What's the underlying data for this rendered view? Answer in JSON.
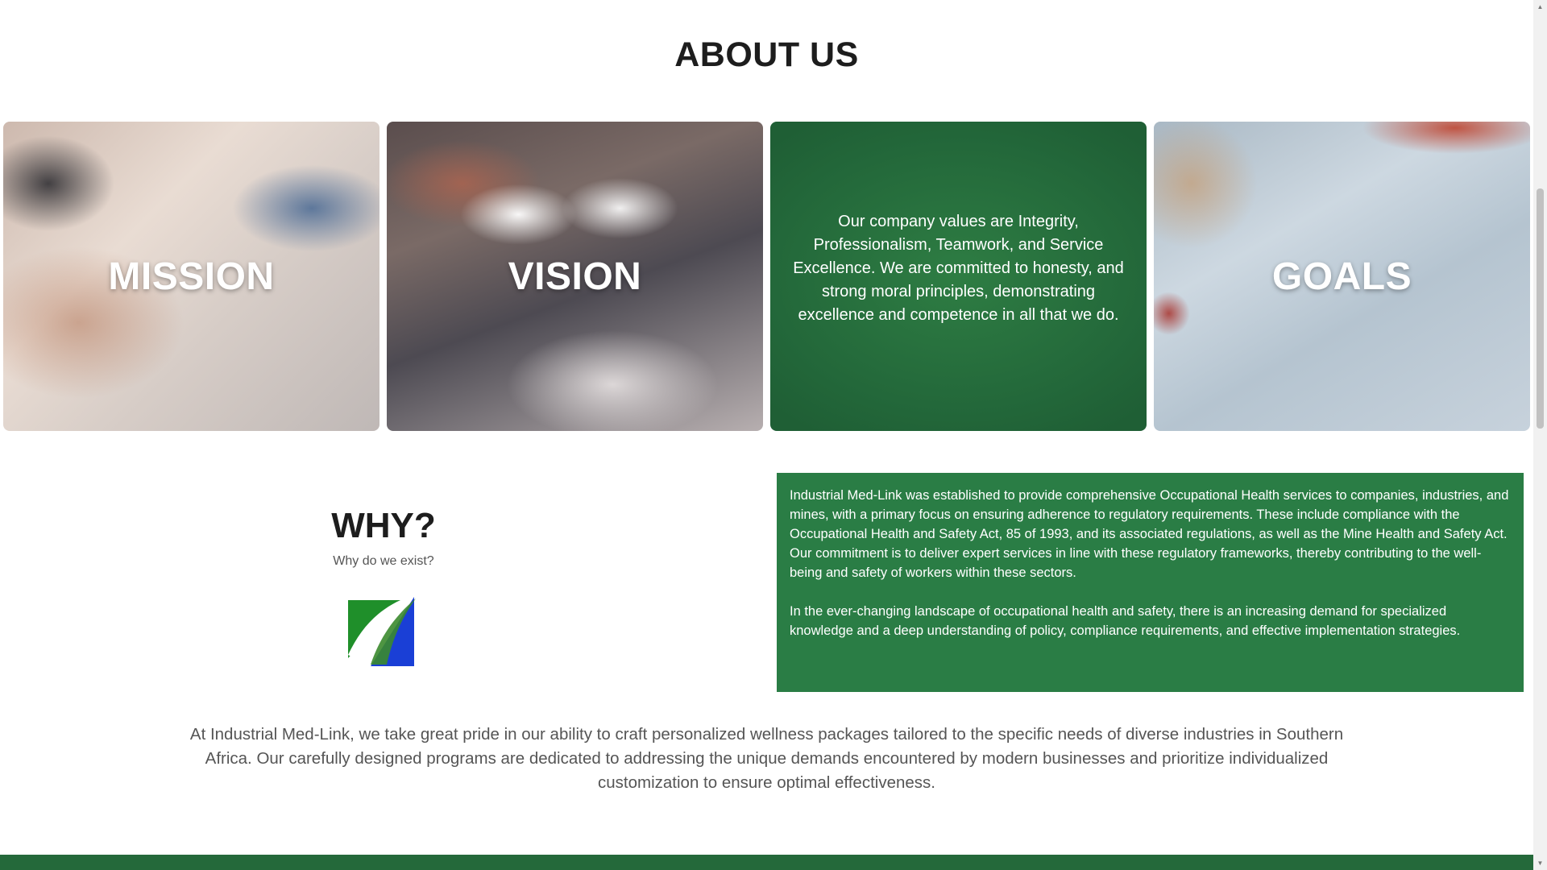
{
  "about": {
    "title": "ABOUT US",
    "cards": [
      {
        "id": "mission",
        "label": "MISSION"
      },
      {
        "id": "vision",
        "label": "VISION"
      },
      {
        "id": "values",
        "text": "Our company values are Integrity, Professionalism, Teamwork, and Service Excellence. We are committed to honesty, and strong moral principles, demonstrating excellence and competence in all that we do."
      },
      {
        "id": "goals",
        "label": "GOALS"
      }
    ]
  },
  "why": {
    "title": "WHY?",
    "subtitle": "Why do we exist?",
    "logo_icon": "industrial-med-link-logo",
    "paragraphs": [
      "Industrial Med-Link was established to provide comprehensive Occupational Health services to companies, industries, and mines, with a primary focus on ensuring adherence to regulatory requirements. These include compliance with the Occupational Health and Safety Act, 85 of 1993, and its associated regulations, as well as the Mine Health and Safety Act. Our commitment is to deliver expert services in line with these regulatory frameworks, thereby contributing to the well-being and safety of workers within these sectors.",
      "In the ever-changing landscape of occupational health and safety, there is an increasing demand for specialized knowledge and a deep understanding of policy, compliance requirements, and effective implementation strategies."
    ]
  },
  "statement": "At Industrial Med-Link, we take great pride in our ability to craft personalized wellness packages tailored to the specific needs of diverse industries in Southern Africa. Our carefully designed programs are dedicated to addressing the unique demands encountered by modern businesses and prioritize individualized customization to ensure optimal effectiveness.",
  "colors": {
    "brand_green": "#2a7d45",
    "heading": "#1d1d1d",
    "body_text": "#555555"
  }
}
